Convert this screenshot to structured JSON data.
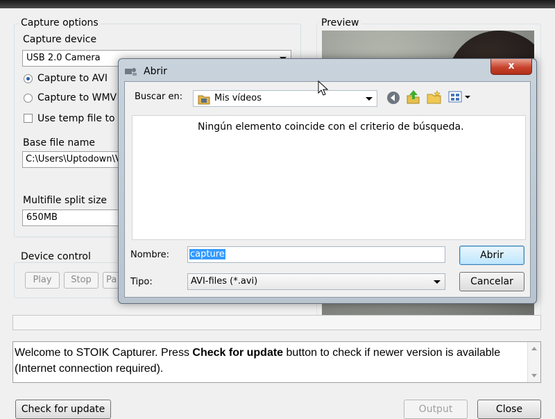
{
  "main": {
    "capture_options": {
      "label": "Capture options",
      "device_label": "Capture device",
      "device_value": "USB 2.0 Camera",
      "radio_avi": "Capture to AVI",
      "radio_wmv": "Capture to WMV",
      "temp_checkbox": "Use temp file to ave",
      "base_label": "Base file name",
      "base_value": "C:\\Users\\Uptodown\\V",
      "split_label": "Multifile split size",
      "split_value": "650MB"
    },
    "device_control": {
      "label": "Device control",
      "play": "Play",
      "stop": "Stop",
      "pause": "Pa"
    },
    "preview_label": "Preview",
    "log": {
      "line1_pre": "Welcome to STOIK Capturer. Press ",
      "line1_bold": "Check for update",
      "line1_post": " button to check if newer version is available",
      "line2": "(Internet connection required)."
    },
    "buttons": {
      "check_update": "Check for update",
      "output": "Output",
      "close": "Close"
    }
  },
  "dialog": {
    "title": "Abrir",
    "close_glyph": "x",
    "look_in_label": "Buscar en:",
    "look_in_value": "Mis vídeos",
    "empty_message": "Ningún elemento coincide con el criterio de búsqueda.",
    "name_label": "Nombre:",
    "name_value": "capture",
    "type_label": "Tipo:",
    "type_value": "AVI-files (*.avi)",
    "open_button": "Abrir",
    "cancel_button": "Cancelar"
  },
  "icons": [
    "back-icon",
    "up-folder-icon",
    "new-folder-icon",
    "view-menu-icon",
    "folder-video-icon",
    "dialog-app-icon",
    "mouse-cursor-icon"
  ]
}
